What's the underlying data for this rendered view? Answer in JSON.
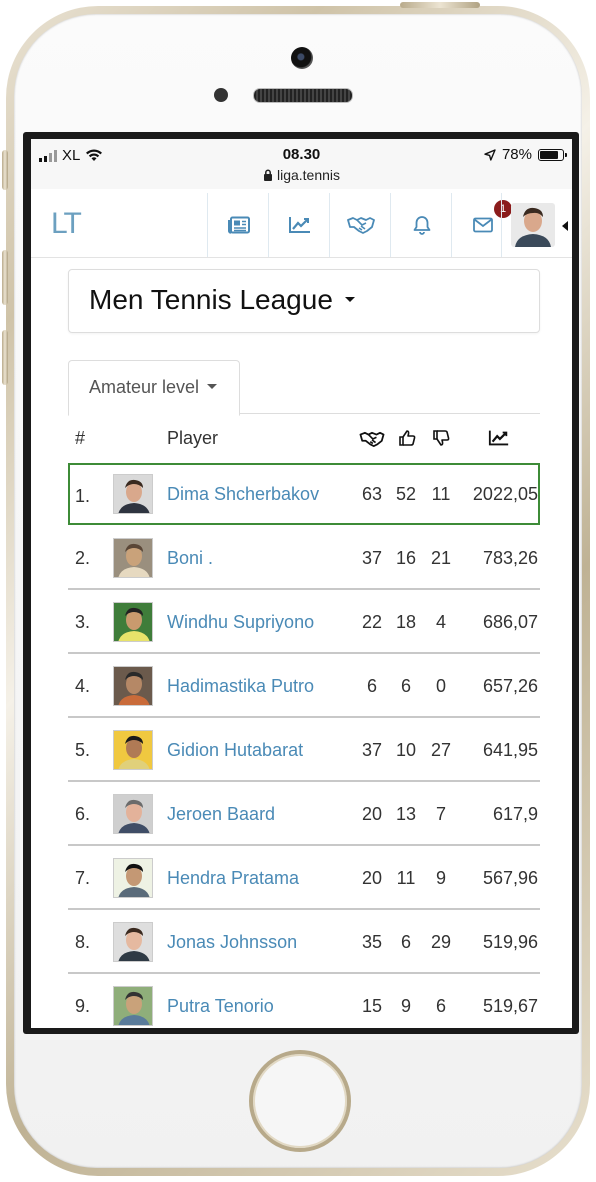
{
  "status_bar": {
    "carrier": "XL",
    "time": "08.30",
    "url": "liga.tennis",
    "battery": "78%"
  },
  "nav": {
    "logo": "LT",
    "items": [
      {
        "name": "news",
        "icon": "newspaper-icon"
      },
      {
        "name": "stats",
        "icon": "chart-line-icon"
      },
      {
        "name": "matches",
        "icon": "handshake-icon"
      },
      {
        "name": "notifications",
        "icon": "bell-icon"
      },
      {
        "name": "messages",
        "icon": "envelope-icon",
        "badge": "1"
      }
    ],
    "avatar_icon": "user-avatar"
  },
  "league": {
    "title": "Men Tennis League"
  },
  "level_tab": {
    "label": "Amateur level"
  },
  "table": {
    "headers": {
      "rank": "#",
      "player": "Player",
      "matches_icon": "handshake-icon",
      "wins_icon": "thumbs-up-icon",
      "losses_icon": "thumbs-down-icon",
      "rating_icon": "chart-line-icon"
    },
    "rows": [
      {
        "rank": "1.",
        "name": "Dima Shcherbakov",
        "matches": "63",
        "wins": "52",
        "losses": "11",
        "rating": "2022,05",
        "highlight": true
      },
      {
        "rank": "2.",
        "name": "Boni .",
        "matches": "37",
        "wins": "16",
        "losses": "21",
        "rating": "783,26"
      },
      {
        "rank": "3.",
        "name": "Windhu Supriyono",
        "matches": "22",
        "wins": "18",
        "losses": "4",
        "rating": "686,07"
      },
      {
        "rank": "4.",
        "name": "Hadimastika Putro",
        "matches": "6",
        "wins": "6",
        "losses": "0",
        "rating": "657,26"
      },
      {
        "rank": "5.",
        "name": "Gidion Hutabarat",
        "matches": "37",
        "wins": "10",
        "losses": "27",
        "rating": "641,95"
      },
      {
        "rank": "6.",
        "name": "Jeroen Baard",
        "matches": "20",
        "wins": "13",
        "losses": "7",
        "rating": "617,9"
      },
      {
        "rank": "7.",
        "name": "Hendra Pratama",
        "matches": "20",
        "wins": "11",
        "losses": "9",
        "rating": "567,96"
      },
      {
        "rank": "8.",
        "name": "Jonas Johnsson",
        "matches": "35",
        "wins": "6",
        "losses": "29",
        "rating": "519,96"
      },
      {
        "rank": "9.",
        "name": "Putra Tenorio",
        "matches": "15",
        "wins": "9",
        "losses": "6",
        "rating": "519,67"
      }
    ]
  },
  "colors": {
    "link": "#4a8ab6",
    "highlight_border": "#3d8b37",
    "badge": "#8b1c1c",
    "nav_icon": "#4a8ab6"
  }
}
